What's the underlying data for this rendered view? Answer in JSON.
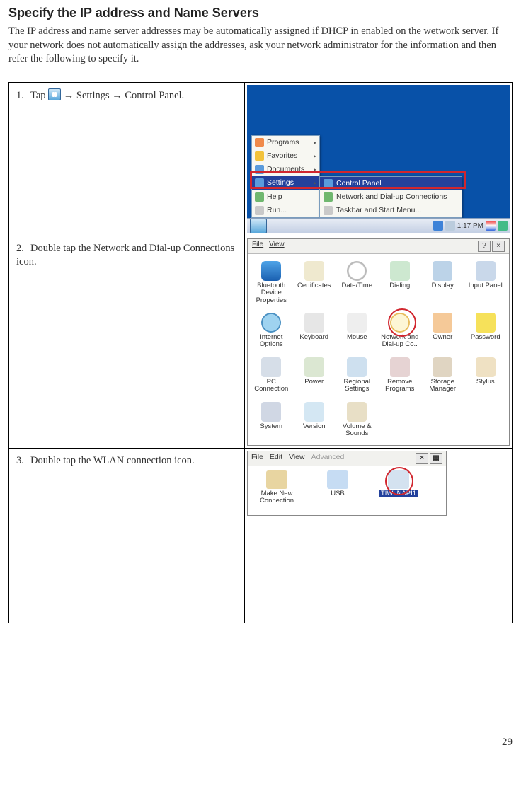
{
  "title": "Specify the IP address and Name Servers",
  "intro": "The IP address and name server addresses may be automatically assigned if DHCP in enabled on the wetwork server. If your network does not automatically assign the addresses, ask your network administrator for the information and then refer the following to specify it.",
  "steps": {
    "s1_num": "1.",
    "s1_a": "Tap ",
    "s1_b": " → Settings → Control Panel.",
    "s2_num": "2.",
    "s2": "Double tap the Network and Dial-up Connections icon.",
    "s3_num": "3.",
    "s3": "Double tap the WLAN connection icon."
  },
  "start_menu": {
    "items": [
      "Programs",
      "Favorites",
      "Documents",
      "Settings",
      "Help",
      "Run..."
    ],
    "sub": [
      "Control Panel",
      "Network and Dial-up Connections",
      "Taskbar and Start Menu..."
    ]
  },
  "taskbar_time": "1:17 PM",
  "cp_menu": {
    "file": "File",
    "view": "View"
  },
  "cp_items": [
    "Bluetooth Device Properties",
    "Certificates",
    "Date/Time",
    "Dialing",
    "Display",
    "Input Panel",
    "Internet Options",
    "Keyboard",
    "Mouse",
    "Network and Dial-up Co..",
    "Owner",
    "Password",
    "PC Connection",
    "Power",
    "Regional Settings",
    "Remove Programs",
    "Storage Manager",
    "Stylus",
    "System",
    "Version",
    "Volume & Sounds"
  ],
  "nc_menu": {
    "file": "File",
    "edit": "Edit",
    "view": "View",
    "adv": "Advanced"
  },
  "nc_items": [
    "Make New Connection",
    "USB",
    "TIWLNAPI1"
  ],
  "page_number": "29"
}
